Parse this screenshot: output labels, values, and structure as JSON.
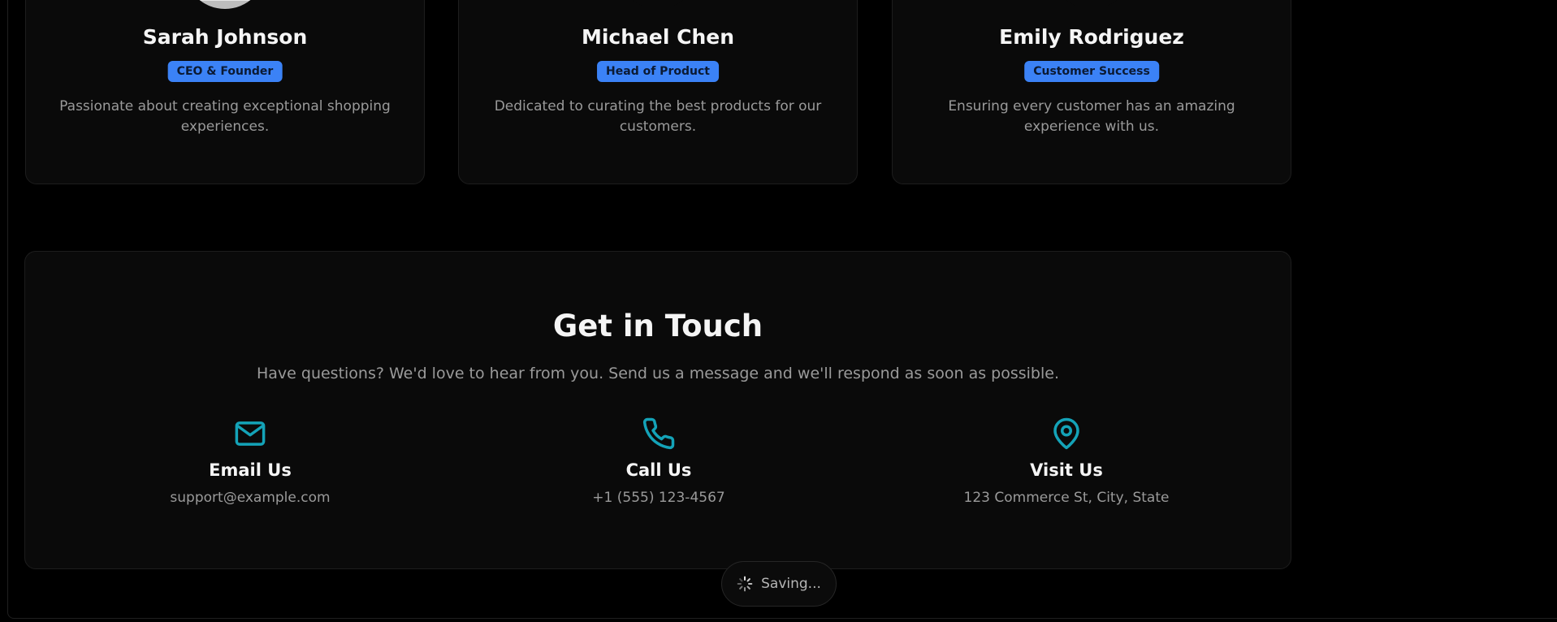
{
  "team": [
    {
      "name": "Sarah Johnson",
      "role": "CEO & Founder",
      "bio": "Passionate about creating exceptional shopping experiences."
    },
    {
      "name": "Michael Chen",
      "role": "Head of Product",
      "bio": "Dedicated to curating the best products for our customers."
    },
    {
      "name": "Emily Rodriguez",
      "role": "Customer Success",
      "bio": "Ensuring every customer has an amazing experience with us."
    }
  ],
  "contact": {
    "title": "Get in Touch",
    "subtitle": "Have questions? We'd love to hear from you. Send us a message and we'll respond as soon as possible.",
    "items": [
      {
        "icon": "mail-icon",
        "label": "Email Us",
        "value": "support@example.com"
      },
      {
        "icon": "phone-icon",
        "label": "Call Us",
        "value": "+1 (555) 123-4567"
      },
      {
        "icon": "map-pin-icon",
        "label": "Visit Us",
        "value": "123 Commerce St, City, State"
      }
    ]
  },
  "status": {
    "saving_label": "Saving..."
  },
  "colors": {
    "accent_blue": "#3b82f6",
    "icon_teal": "#14a3b8",
    "background": "#000000",
    "card": "#0a0a0a"
  }
}
